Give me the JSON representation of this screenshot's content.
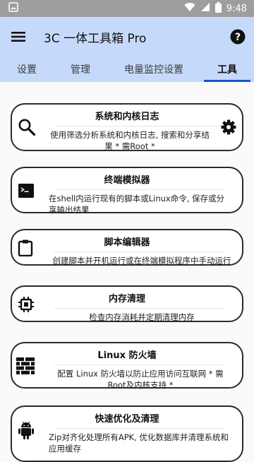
{
  "status_bar": {
    "time": "9:48"
  },
  "app_bar": {
    "title": "3C 一体工具箱 Pro"
  },
  "tabs": [
    {
      "label": "设置"
    },
    {
      "label": "管理"
    },
    {
      "label": "电量监控设置"
    },
    {
      "label": "工具",
      "active": true
    }
  ],
  "tools": [
    {
      "title": "系统和内核日志",
      "description": "使用筛选分析系统和内核日志, 搜索和分享结果 * 需Root *",
      "icon": "search-icon",
      "action_icon": "gear-icon"
    },
    {
      "title": "终端模拟器",
      "description": "在shell内运行现有的脚本或Linux命令, 保存或分享输出结果",
      "icon": "terminal-icon"
    },
    {
      "title": "脚本编辑器",
      "description": "创建脚本并开机运行或在终端模拟程序中手动运行",
      "icon": "clipboard-icon"
    },
    {
      "title": "内存清理",
      "description": "检查内存消耗并定期清理内存",
      "icon": "memory-chip-icon"
    },
    {
      "title": "Linux 防火墙",
      "description": "配置 Linux 防火墙以防止应用访问互联网 * 需Root及内核支持 *",
      "icon": "firewall-icon"
    },
    {
      "title": "快速优化及清理",
      "description": "Zip对齐化处理所有APK, 优化数据库并清理系统和应用缓存",
      "icon": "android-icon"
    }
  ],
  "colors": {
    "app_bar": "#c5dafa",
    "tab_indicator": "#1a56c9",
    "status_bar": "#9e9e9e"
  }
}
